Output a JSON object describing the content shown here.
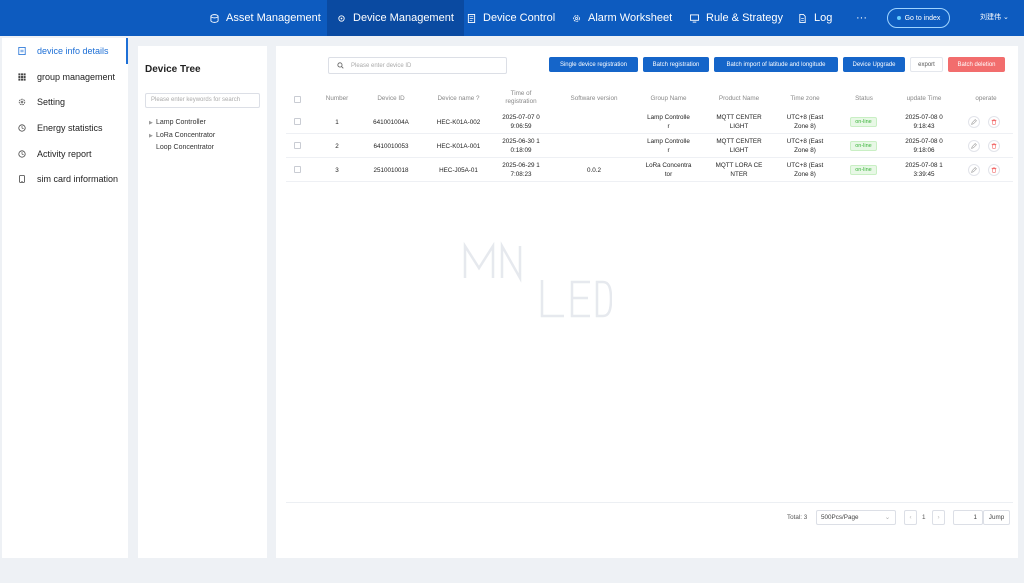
{
  "nav": {
    "items": [
      {
        "label": "Asset Management",
        "icon": "database-icon"
      },
      {
        "label": "Device Management",
        "icon": "gear-icon",
        "active": true
      },
      {
        "label": "Device Control",
        "icon": "document-icon"
      },
      {
        "label": "Alarm Worksheet",
        "icon": "settings-icon"
      },
      {
        "label": "Rule & Strategy",
        "icon": "monitor-icon"
      },
      {
        "label": "Log",
        "icon": "file-icon"
      },
      {
        "label": "···",
        "icon": "more-icon"
      }
    ],
    "goto_label": "Go to index",
    "user": "刘建伟 ⌄"
  },
  "sidebar": {
    "items": [
      {
        "label": "device info details",
        "icon": "document-icon",
        "active": true
      },
      {
        "label": "group management",
        "icon": "grid-icon"
      },
      {
        "label": "Setting",
        "icon": "gear-icon"
      },
      {
        "label": "Energy statistics",
        "icon": "clock-icon"
      },
      {
        "label": "Activity report",
        "icon": "clock-icon"
      },
      {
        "label": "sim card information",
        "icon": "phone-icon"
      }
    ]
  },
  "tree": {
    "title": "Device Tree",
    "search_placeholder": "Please enter keywords for search",
    "nodes": [
      "Lamp Controller",
      "LoRa Concentrator",
      "Loop Concentrator"
    ]
  },
  "toolbar": {
    "search_placeholder": "Please enter device ID",
    "single_registration": "Single device registration",
    "batch_registration": "Batch registration",
    "batch_import": "Batch import of latitude and longitude",
    "device_upgrade": "Device Upgrade",
    "export": "export",
    "batch_deletion": "Batch deletion"
  },
  "table": {
    "headers": {
      "number": "Number",
      "device_id": "Device ID",
      "device_name": "Device name",
      "time_reg_1": "Time of",
      "time_reg_2": "registration",
      "software": "Software version",
      "group": "Group Name",
      "product": "Product Name",
      "timezone": "Time zone",
      "status": "Status",
      "update": "update Time",
      "operate": "operate"
    },
    "rows": [
      {
        "number": "1",
        "device_id": "641001004A",
        "device_name": "HEC-K01A-002",
        "reg_1": "2025-07-07 0",
        "reg_2": "9:06:59",
        "software": "",
        "group_1": "Lamp Controlle",
        "group_2": "r",
        "product_1": "MQTT CENTER",
        "product_2": "LIGHT",
        "tz_1": "UTC+8 (East",
        "tz_2": "Zone 8)",
        "status": "on-line",
        "upd_1": "2025-07-08 0",
        "upd_2": "9:18:43"
      },
      {
        "number": "2",
        "device_id": "6410010053",
        "device_name": "HEC-K01A-001",
        "reg_1": "2025-06-30 1",
        "reg_2": "0:18:09",
        "software": "",
        "group_1": "Lamp Controlle",
        "group_2": "r",
        "product_1": "MQTT CENTER",
        "product_2": "LIGHT",
        "tz_1": "UTC+8 (East",
        "tz_2": "Zone 8)",
        "status": "on-line",
        "upd_1": "2025-07-08 0",
        "upd_2": "9:18:06"
      },
      {
        "number": "3",
        "device_id": "2510010018",
        "device_name": "HEC-J05A-01",
        "reg_1": "2025-06-29 1",
        "reg_2": "7:08:23",
        "software": "0.0.2",
        "group_1": "LoRa Concentra",
        "group_2": "tor",
        "product_1": "MQTT LORA CE",
        "product_2": "NTER",
        "tz_1": "UTC+8 (East",
        "tz_2": "Zone 8)",
        "status": "on-line",
        "upd_1": "2025-07-08 1",
        "upd_2": "3:39:45"
      }
    ]
  },
  "pager": {
    "total": "Total: 3",
    "page_size": "500Pcs/Page",
    "current": "1",
    "jump_value": "1",
    "jump_label": "Jump"
  },
  "colors": {
    "nav_bg": "#0d5bbf",
    "accent": "#1565c9",
    "danger": "#f26d6d",
    "online": "#3bb33b"
  }
}
